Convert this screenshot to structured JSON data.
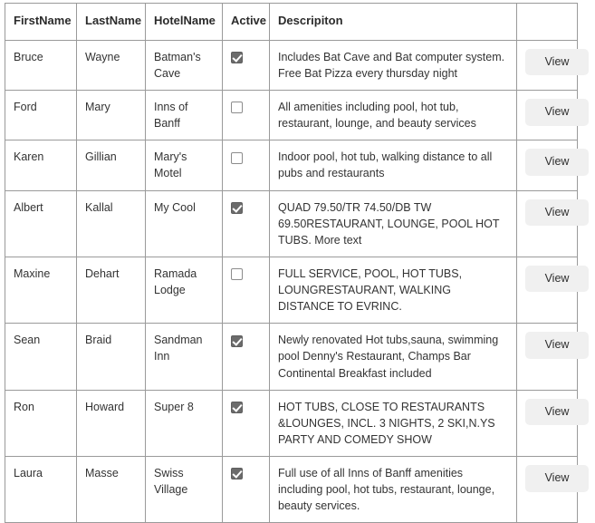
{
  "table": {
    "columns": [
      {
        "key": "first_name",
        "label": "FirstName"
      },
      {
        "key": "last_name",
        "label": "LastName"
      },
      {
        "key": "hotel_name",
        "label": "HotelName"
      },
      {
        "key": "active",
        "label": "Active"
      },
      {
        "key": "description",
        "label": "Descripiton"
      },
      {
        "key": "action",
        "label": ""
      }
    ],
    "action_label": "View",
    "highlight_color": "#a9c0da",
    "rows": [
      {
        "first_name": "Bruce",
        "last_name": "Wayne",
        "hotel_name": "Batman's Cave",
        "active": true,
        "description": "Includes Bat Cave and Bat computer system. Free Bat Pizza every thursday night",
        "highlighted": true,
        "action_label": "View"
      },
      {
        "first_name": "Ford",
        "last_name": "Mary",
        "hotel_name": "Inns of Banff",
        "active": false,
        "description": "All amenities including pool, hot tub, restaurant, lounge, and beauty services",
        "highlighted": false,
        "action_label": "View"
      },
      {
        "first_name": "Karen",
        "last_name": "Gillian",
        "hotel_name": "Mary's Motel",
        "active": false,
        "description": "Indoor pool, hot tub, walking distance to all pubs and restaurants",
        "highlighted": false,
        "action_label": "View"
      },
      {
        "first_name": "Albert",
        "last_name": "Kallal",
        "hotel_name": "My Cool",
        "active": true,
        "description": "QUAD 79.50/TR 74.50/DB TW 69.50RESTAURANT, LOUNGE, POOL HOT TUBS. More text",
        "highlighted": true,
        "action_label": "View"
      },
      {
        "first_name": "Maxine",
        "last_name": "Dehart",
        "hotel_name": "Ramada Lodge",
        "active": false,
        "description": "FULL SERVICE, POOL, HOT TUBS, LOUNGRESTAURANT, WALKING DISTANCE TO EVRINC.",
        "highlighted": false,
        "action_label": "View"
      },
      {
        "first_name": "Sean",
        "last_name": "Braid",
        "hotel_name": "Sandman Inn",
        "active": true,
        "description": "Newly renovated Hot tubs,sauna, swimming pool Denny's Restaurant, Champs Bar Continental Breakfast included",
        "highlighted": true,
        "action_label": "View"
      },
      {
        "first_name": "Ron",
        "last_name": "Howard",
        "hotel_name": "Super 8",
        "active": true,
        "description": "HOT TUBS, CLOSE TO RESTAURANTS &LOUNGES, INCL. 3 NIGHTS, 2 SKI,N.YS PARTY AND COMEDY SHOW",
        "highlighted": true,
        "action_label": "View"
      },
      {
        "first_name": "Laura",
        "last_name": "Masse",
        "hotel_name": "Swiss Village",
        "active": true,
        "description": "Full use of all Inns of Banff amenities including pool, hot tubs, restaurant, lounge, beauty services.",
        "highlighted": true,
        "action_label": "View"
      }
    ]
  }
}
